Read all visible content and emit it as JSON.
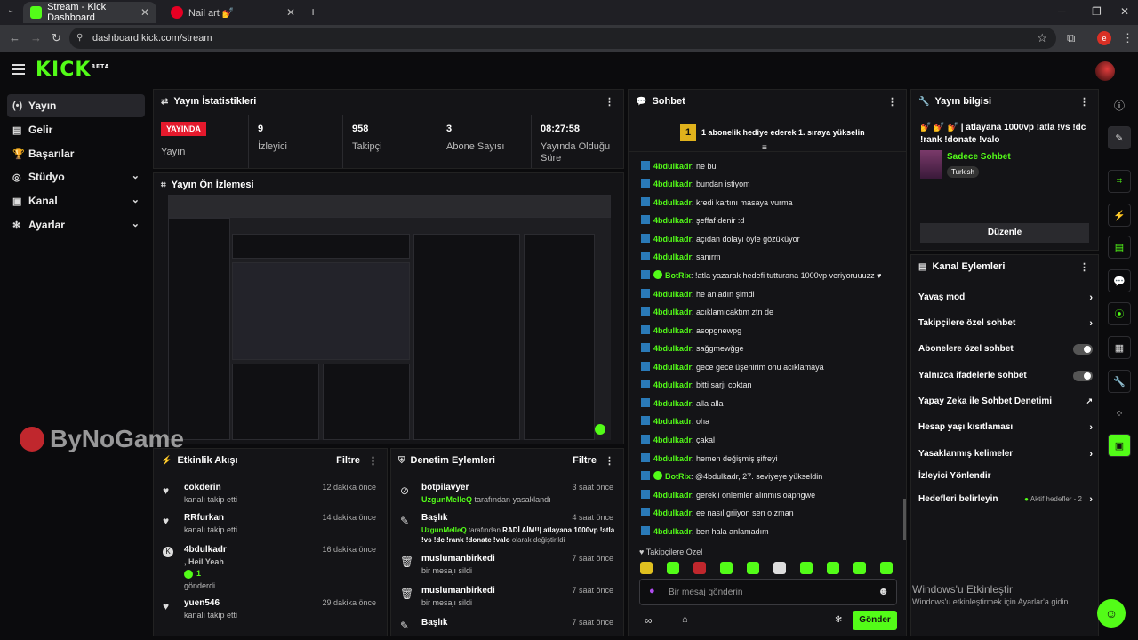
{
  "browser": {
    "tabs": [
      {
        "title": "Stream - Kick Dashboard",
        "active": true
      },
      {
        "title": "Nail art 💅",
        "active": false
      }
    ],
    "url": "dashboard.kick.com/stream",
    "new_tab": "+",
    "tab_close": "✕",
    "window_controls": [
      "─",
      "❐",
      "✕"
    ],
    "profile_initial": "e"
  },
  "app": {
    "logo_text": "KICK",
    "logo_sup": "BETA"
  },
  "sidebar": {
    "items": [
      {
        "label": "Yayın",
        "icon": "broadcast-icon",
        "glyph": "(•)",
        "active": true
      },
      {
        "label": "Gelir",
        "icon": "revenue-icon",
        "glyph": "▤"
      },
      {
        "label": "Başarılar",
        "icon": "trophy-icon",
        "glyph": "🏆"
      },
      {
        "label": "Stüdyo",
        "icon": "studio-icon",
        "glyph": "◎",
        "expand": true
      },
      {
        "label": "Kanal",
        "icon": "channel-icon",
        "glyph": "▣",
        "expand": true
      },
      {
        "label": "Ayarlar",
        "icon": "settings-icon",
        "glyph": "✻",
        "expand": true
      }
    ]
  },
  "stats": {
    "title": "Yayın İstatistikleri",
    "live_badge": "YAYINDA",
    "live_label": "Yayın",
    "items": [
      {
        "value": "9",
        "label": "İzleyici"
      },
      {
        "value": "958",
        "label": "Takipçi"
      },
      {
        "value": "3",
        "label": "Abone Sayısı"
      },
      {
        "value": "08:27:58",
        "label": "Yayında Olduğu Süre"
      }
    ]
  },
  "preview": {
    "title": "Yayın Ön İzlemesi"
  },
  "watermark": {
    "text": "ByNoGame"
  },
  "activity": {
    "title": "Etkinlik Akışı",
    "filter": "Filtre",
    "items": [
      {
        "name": "cokderin",
        "sub": "kanalı takip etti",
        "time": "12 dakika önce",
        "icon": "heart-icon"
      },
      {
        "name": "RRfurkan",
        "sub": "kanalı takip etti",
        "time": "14 dakika önce",
        "icon": "heart-icon"
      },
      {
        "name": "4bdulkadr",
        "msg": ", Heil Yeah",
        "amount": "1",
        "sub": "gönderdi",
        "time": "16 dakika önce",
        "icon": "kick-coin-icon"
      },
      {
        "name": "yuen546",
        "sub": "kanalı takip etti",
        "time": "29 dakika önce",
        "icon": "heart-icon"
      }
    ]
  },
  "moderation": {
    "title": "Denetim Eylemleri",
    "filter": "Filtre",
    "items": [
      {
        "name": "botpilavyer",
        "by": "UzgunMelleQ",
        "sub": "tarafından yasaklandı",
        "time": "3 saat önce"
      },
      {
        "name": "Başlık",
        "by": "UzgunMelleQ",
        "sub": "tarafından",
        "title_val": "RADİ AİM!!| atlayana 1000vp !atla !vs !dc !rank !donate !valo",
        "sub2": "olarak değiştirildi",
        "time": "4 saat önce"
      },
      {
        "name": "muslumanbirkedi",
        "sub": "bir mesajı sildi",
        "time": "7 saat önce"
      },
      {
        "name": "muslumanbirkedi",
        "sub": "bir mesajı sildi",
        "time": "7 saat önce"
      },
      {
        "name": "Başlık",
        "sub": "",
        "time": "7 saat önce"
      }
    ]
  },
  "chat": {
    "title": "Sohbet",
    "pinned_rank": "1",
    "pinned": "1 abonelik hediye ederek 1. sıraya yükselin",
    "messages": [
      {
        "user": "4bdulkadr",
        "text": "ne bu"
      },
      {
        "user": "4bdulkadr",
        "text": "bundan istiyom"
      },
      {
        "user": "4bdulkadr",
        "text": "kredi kartını masaya vurma"
      },
      {
        "user": "4bdulkadr",
        "text": "şeffaf denir :d"
      },
      {
        "user": "4bdulkadr",
        "text": "açıdan dolayı öyle gözüküyor"
      },
      {
        "user": "4bdulkadr",
        "text": "sanırm"
      },
      {
        "user": "BotRix",
        "text": "!atla yazarak hedefi tutturana 1000vp veriyoruuuzz ♥"
      },
      {
        "user": "4bdulkadr",
        "text": "he anladın şimdi"
      },
      {
        "user": "4bdulkadr",
        "text": "acıklamıcaktım ztn de"
      },
      {
        "user": "4bdulkadr",
        "text": "asopgnewpg"
      },
      {
        "user": "4bdulkadr",
        "text": "sağgmewğge"
      },
      {
        "user": "4bdulkadr",
        "text": "gece gece üşenirim onu acıklamaya"
      },
      {
        "user": "4bdulkadr",
        "text": "bitti sarjı coktan"
      },
      {
        "user": "4bdulkadr",
        "text": "alla alla"
      },
      {
        "user": "4bdulkadr",
        "text": "oha"
      },
      {
        "user": "4bdulkadr",
        "text": "çakal"
      },
      {
        "user": "4bdulkadr",
        "text": "hemen değişmiş şifreyi"
      },
      {
        "user": "BotRix",
        "text": "@4bdulkadr, 27. seviyeye yükseldin"
      },
      {
        "user": "4bdulkadr",
        "text": "gerekli onlemler alınmıs oapngwe"
      },
      {
        "user": "4bdulkadr",
        "text": "ee nasıl griiyon sen o zman"
      },
      {
        "user": "4bdulkadr",
        "text": "ben hala anlamadım"
      }
    ],
    "emote_section": "Takipçilere Özel",
    "input_placeholder": "Bir mesaj gönderin",
    "send": "Gönder"
  },
  "stream_info": {
    "title": "Yayın bilgisi",
    "stream_title": "💅 💅 💅 | atlayana 1000vp !atla !vs !dc !rank !donate !valo",
    "category": "Sadece Sohbet",
    "tag": "Turkish",
    "edit": "Düzenle"
  },
  "channel_actions": {
    "title": "Kanal Eylemleri",
    "items": [
      {
        "label": "Yavaş mod",
        "control": "arrow"
      },
      {
        "label": "Takipçilere özel sohbet",
        "control": "arrow"
      },
      {
        "label": "Abonelere özel sohbet",
        "control": "toggle"
      },
      {
        "label": "Yalnızca ifadelerle sohbet",
        "control": "toggle"
      },
      {
        "label": "Yapay Zeka ile Sohbet Denetimi",
        "control": "external"
      },
      {
        "label": "Hesap yaşı kısıtlaması",
        "control": "arrow"
      },
      {
        "label": "Yasaklanmış kelimeler",
        "control": "arrow"
      },
      {
        "label": "İzleyici Yönlendir",
        "control": "none"
      },
      {
        "label": "Hedefleri belirleyin",
        "control": "arrow",
        "extra": "Aktif hedefler - 2"
      }
    ]
  },
  "windows_activation": {
    "title": "Windows'u Etkinleştir",
    "sub": "Windows'u etkinleştirmek için Ayarlar'a gidin."
  },
  "colors": {
    "accent": "#53fc18",
    "live": "#e5192c"
  }
}
